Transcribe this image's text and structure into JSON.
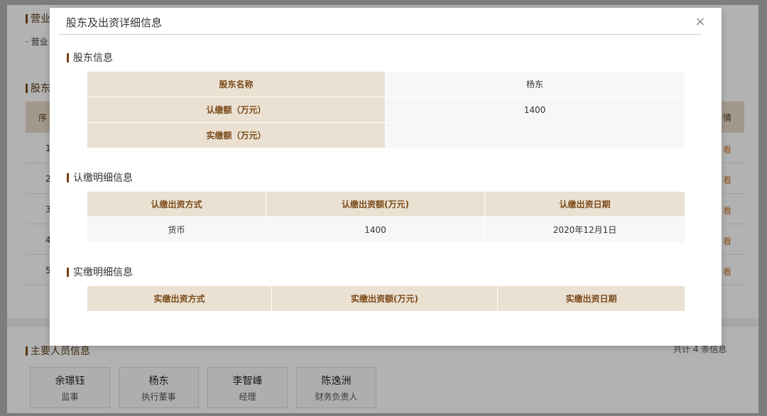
{
  "background": {
    "section1_title": "营业",
    "section1_sub": "· 营业",
    "section2_title": "股东",
    "table_head_left": "序",
    "table_head_right": "情",
    "row_numbers": [
      "1",
      "2",
      "3",
      "4",
      "5"
    ],
    "row_link": "看",
    "section3_title": "主要人员信息",
    "count_text": "共计 4 条信息",
    "people": [
      {
        "name": "余璟钰",
        "role": "监事"
      },
      {
        "name": "杨东",
        "role": "执行董事"
      },
      {
        "name": "李智峰",
        "role": "经理"
      },
      {
        "name": "陈逸洲",
        "role": "财务负责人"
      }
    ]
  },
  "modal": {
    "title": "股东及出资详细信息",
    "close_glyph": "×",
    "shareholder_section": {
      "title": "股东信息",
      "rows": [
        {
          "label": "股东名称",
          "value": "杨东"
        },
        {
          "label": "认缴额（万元）",
          "value": "1400"
        },
        {
          "label": "实缴额（万元）",
          "value": ""
        }
      ]
    },
    "subscribed_section": {
      "title": "认缴明细信息",
      "headers": [
        "认缴出资方式",
        "认缴出资额(万元)",
        "认缴出资日期"
      ],
      "rows": [
        [
          "货币",
          "1400",
          "2020年12月1日"
        ]
      ]
    },
    "paid_section": {
      "title": "实缴明细信息",
      "headers": [
        "实缴出资方式",
        "实缴出资额(万元)",
        "实缴出资日期"
      ],
      "rows": []
    }
  },
  "colors": {
    "accent_bar": "#7a3e0c",
    "header_bg": "#ebe1d3",
    "header_text": "#7a4a18",
    "link": "#c8782a"
  }
}
